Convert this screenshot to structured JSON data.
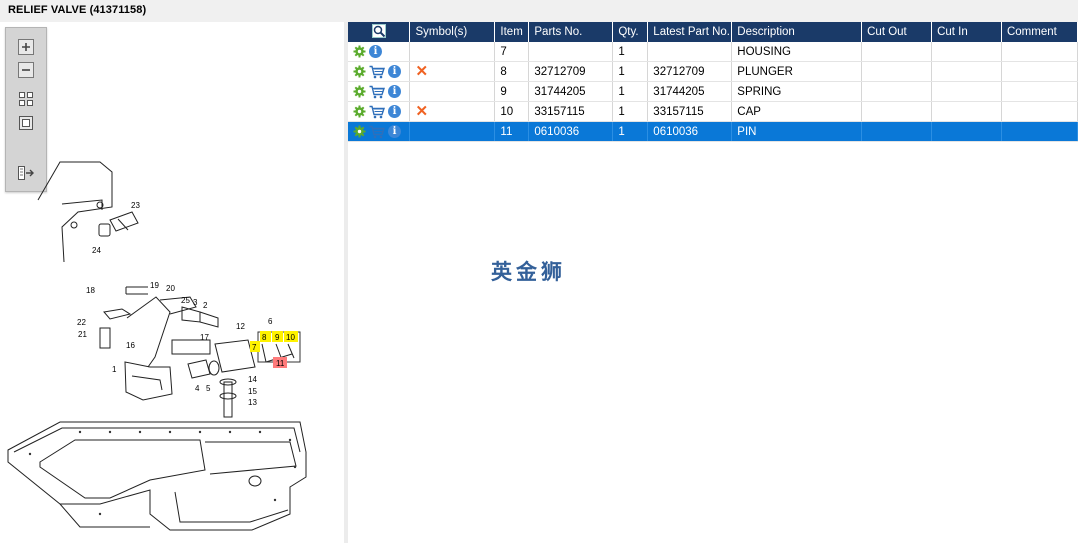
{
  "window": {
    "title": "RELIEF VALVE (41371158)"
  },
  "toolbar": {
    "buttons": [
      {
        "icon": "zoom-in-icon"
      },
      {
        "icon": "zoom-out-icon"
      },
      {
        "icon": "fit-grid-icon"
      },
      {
        "icon": "fit-page-icon"
      },
      {
        "icon": "export-icon"
      }
    ]
  },
  "diagram": {
    "callouts": [
      "23",
      "24",
      "18",
      "19",
      "20",
      "25",
      "3",
      "2",
      "22",
      "21",
      "16",
      "17",
      "12",
      "6",
      "7",
      "8",
      "9",
      "10",
      "11",
      "1",
      "4",
      "5",
      "14",
      "15",
      "13"
    ]
  },
  "table": {
    "columns": [
      "Symbol(s)",
      "Item",
      "Parts No.",
      "Qty.",
      "Latest Part No.",
      "Description",
      "Cut Out",
      "Cut In",
      "Comment"
    ],
    "rows": [
      {
        "item": "7",
        "parts_no": "",
        "qty": "1",
        "latest": "",
        "description": "HOUSING",
        "cut_out": "",
        "cut_in": "",
        "comment": "",
        "cart": false,
        "cross": false
      },
      {
        "item": "8",
        "parts_no": "32712709",
        "qty": "1",
        "latest": "32712709",
        "description": "PLUNGER",
        "cut_out": "",
        "cut_in": "",
        "comment": "",
        "cart": true,
        "cross": true
      },
      {
        "item": "9",
        "parts_no": "31744205",
        "qty": "1",
        "latest": "31744205",
        "description": "SPRING",
        "cut_out": "",
        "cut_in": "",
        "comment": "",
        "cart": true,
        "cross": false
      },
      {
        "item": "10",
        "parts_no": "33157115",
        "qty": "1",
        "latest": "33157115",
        "description": "CAP",
        "cut_out": "",
        "cut_in": "",
        "comment": "",
        "cart": true,
        "cross": true
      },
      {
        "item": "11",
        "parts_no": "0610036",
        "qty": "1",
        "latest": "0610036",
        "description": "PIN",
        "cut_out": "",
        "cut_in": "",
        "comment": "",
        "cart": true,
        "cross": false,
        "selected": true
      }
    ]
  },
  "watermark": "英金狮",
  "colors": {
    "header_bg": "#1a3a68",
    "selected_row": "#0a78d7",
    "highlight_yellow": "#fff200",
    "highlight_red": "#ff7b7b",
    "cross_orange": "#f06222"
  }
}
